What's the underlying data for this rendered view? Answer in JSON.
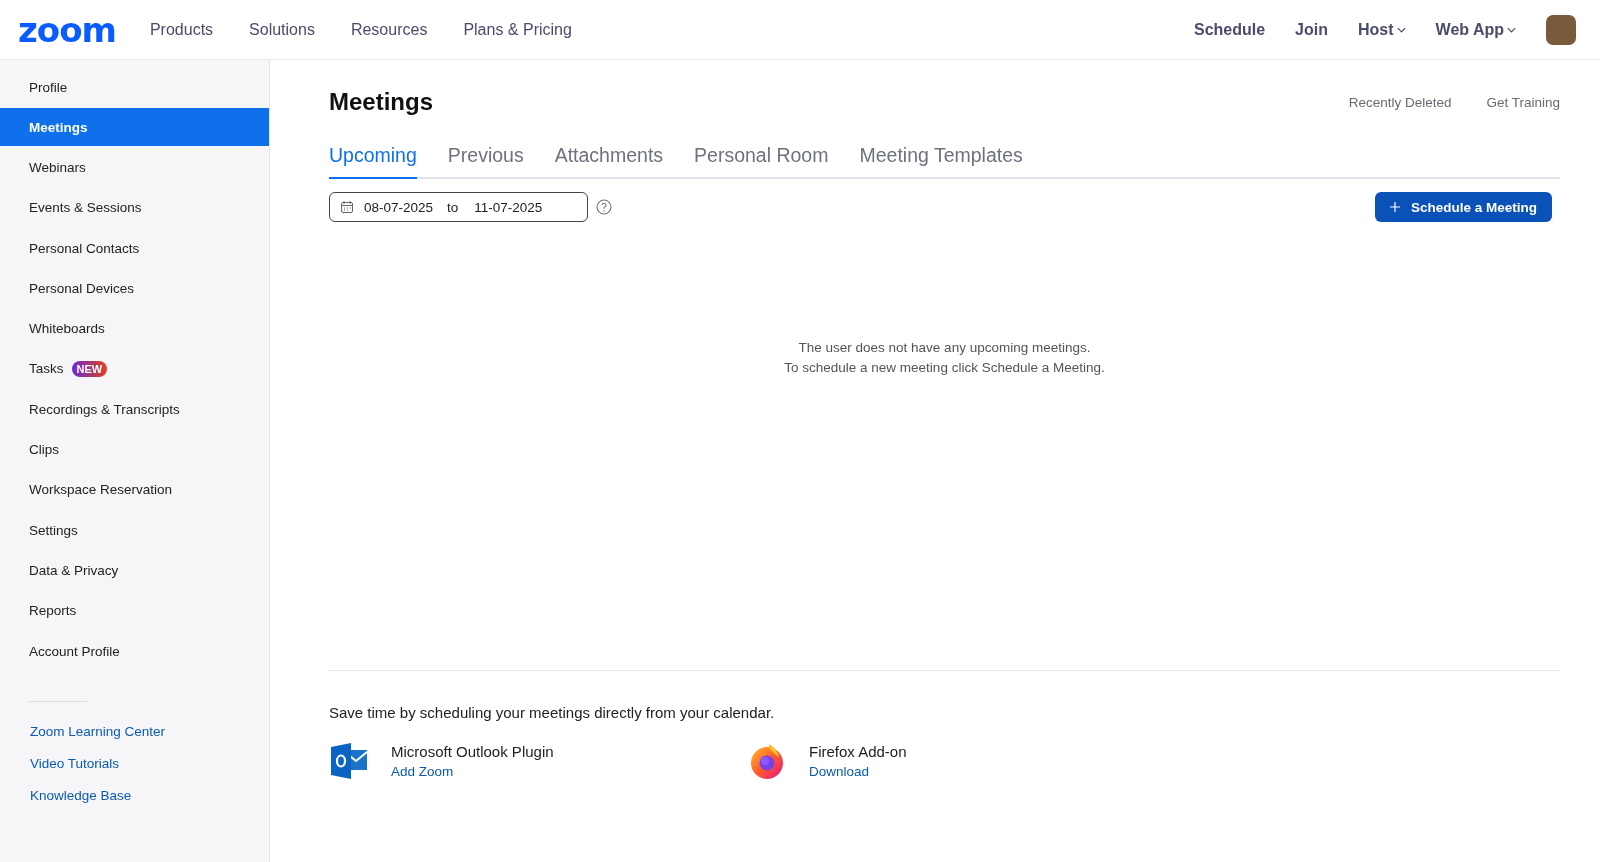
{
  "header": {
    "logo": "zoom",
    "nav": [
      "Products",
      "Solutions",
      "Resources",
      "Plans & Pricing"
    ],
    "actions": [
      {
        "label": "Schedule",
        "dropdown": false
      },
      {
        "label": "Join",
        "dropdown": false
      },
      {
        "label": "Host",
        "dropdown": true
      },
      {
        "label": "Web App",
        "dropdown": true
      }
    ]
  },
  "sidebar": {
    "items": [
      {
        "label": "Profile",
        "selected": false
      },
      {
        "label": "Meetings",
        "selected": true
      },
      {
        "label": "Webinars",
        "selected": false
      },
      {
        "label": "Events & Sessions",
        "selected": false
      },
      {
        "label": "Personal Contacts",
        "selected": false
      },
      {
        "label": "Personal Devices",
        "selected": false
      },
      {
        "label": "Whiteboards",
        "selected": false
      },
      {
        "label": "Tasks",
        "selected": false,
        "badge": "NEW"
      },
      {
        "label": "Recordings & Transcripts",
        "selected": false
      },
      {
        "label": "Clips",
        "selected": false
      },
      {
        "label": "Workspace Reservation",
        "selected": false
      },
      {
        "label": "Settings",
        "selected": false
      },
      {
        "label": "Data & Privacy",
        "selected": false
      },
      {
        "label": "Reports",
        "selected": false
      },
      {
        "label": "Account Profile",
        "selected": false
      }
    ],
    "links": [
      "Zoom Learning Center",
      "Video Tutorials",
      "Knowledge Base"
    ]
  },
  "page": {
    "title": "Meetings",
    "links": [
      "Recently Deleted",
      "Get Training"
    ],
    "tabs": [
      {
        "label": "Upcoming",
        "selected": true
      },
      {
        "label": "Previous",
        "selected": false
      },
      {
        "label": "Attachments",
        "selected": false
      },
      {
        "label": "Personal Room",
        "selected": false
      },
      {
        "label": "Meeting Templates",
        "selected": false
      }
    ],
    "date_range": {
      "from": "08-07-2025",
      "separator": "to",
      "to": "11-07-2025"
    },
    "schedule_button": "Schedule a Meeting",
    "empty_message": [
      "The user does not have any upcoming meetings.",
      "To schedule a new meeting click Schedule a Meeting."
    ],
    "calendar_note": "Save time by scheduling your meetings directly from your calendar.",
    "plugins": [
      {
        "kind": "outlook",
        "name": "Microsoft Outlook Plugin",
        "link": "Add Zoom"
      },
      {
        "kind": "firefox",
        "name": "Firefox Add-on",
        "link": "Download"
      }
    ]
  }
}
